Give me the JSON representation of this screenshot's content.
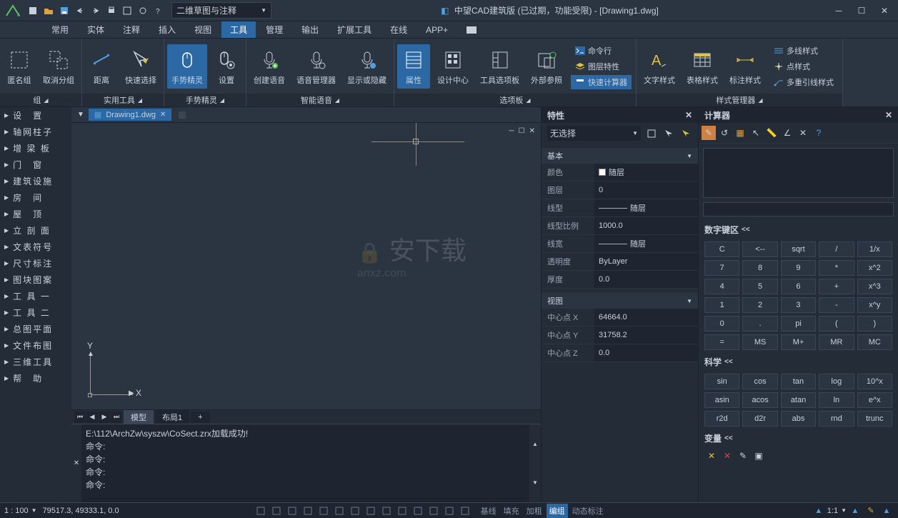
{
  "titlebar": {
    "workspace": "二维草图与注释",
    "title": "中望CAD建筑版 (已过期，功能受限) - [Drawing1.dwg]"
  },
  "menubar": {
    "items": [
      "常用",
      "实体",
      "注释",
      "插入",
      "视图",
      "工具",
      "管理",
      "输出",
      "扩展工具",
      "在线",
      "APP+"
    ],
    "active_index": 5
  },
  "ribbon": {
    "groups": [
      {
        "label": "组",
        "buttons": [
          {
            "label": "匿名组",
            "icon": "group-dashed"
          },
          {
            "label": "取消分组",
            "icon": "ungroup"
          }
        ]
      },
      {
        "label": "实用工具",
        "buttons": [
          {
            "label": "距离",
            "icon": "measure-arrow"
          },
          {
            "label": "快速选择",
            "icon": "quick-select"
          }
        ]
      },
      {
        "label": "手势精灵",
        "buttons": [
          {
            "label": "手势精灵",
            "icon": "mouse",
            "active": true
          },
          {
            "label": "设置",
            "icon": "mouse-gear"
          }
        ]
      },
      {
        "label": "智能语音",
        "buttons": [
          {
            "label": "创建语音",
            "icon": "mic-add"
          },
          {
            "label": "语音管理器",
            "icon": "mic-gear"
          },
          {
            "label": "显示或隐藏",
            "icon": "mic-toggle"
          }
        ]
      },
      {
        "label": "选项板",
        "buttons": [
          {
            "label": "属性",
            "icon": "panel-props",
            "active": true
          },
          {
            "label": "设计中心",
            "icon": "panel-design"
          },
          {
            "label": "工具选项板",
            "icon": "panel-toolbox"
          },
          {
            "label": "外部参照",
            "icon": "panel-xref"
          }
        ],
        "side": [
          {
            "label": "命令行",
            "icon": "cmd"
          },
          {
            "label": "图层特性",
            "icon": "layers"
          },
          {
            "label": "快速计算器",
            "icon": "calc",
            "highlight": true
          }
        ]
      },
      {
        "label": "样式管理器",
        "buttons": [
          {
            "label": "文字样式",
            "icon": "text-style"
          },
          {
            "label": "表格样式",
            "icon": "table-style"
          },
          {
            "label": "标注样式",
            "icon": "dim-style"
          }
        ],
        "side": [
          {
            "label": "多线样式",
            "icon": "mline"
          },
          {
            "label": "点样式",
            "icon": "point"
          },
          {
            "label": "多重引线样式",
            "icon": "mleader"
          }
        ]
      }
    ]
  },
  "sidebar": {
    "items": [
      "设　置",
      "轴网柱子",
      "增 梁 板",
      "门　窗",
      "建筑设施",
      "房　间",
      "屋　顶",
      "立 剖 面",
      "文表符号",
      "尺寸标注",
      "图块图案",
      "工 具 一",
      "工 具 二",
      "总图平面",
      "文件布图",
      "三维工具",
      "帮　助"
    ]
  },
  "doc": {
    "tab_name": "Drawing1.dwg",
    "view_tabs": [
      "模型",
      "布局1"
    ],
    "watermark": "安下载"
  },
  "cmd": {
    "lines": [
      "E:\\112\\ArchZw\\syszw\\CoSect.zrx加载成功!",
      "命令:",
      "命令:",
      "命令:",
      "命令:"
    ]
  },
  "props": {
    "title": "特性",
    "no_select": "无选择",
    "sections": {
      "basic": {
        "label": "基本",
        "rows": [
          {
            "label": "颜色",
            "value": "随层",
            "swatch": true
          },
          {
            "label": "图层",
            "value": "0"
          },
          {
            "label": "线型",
            "value": "随层",
            "line": true
          },
          {
            "label": "线型比例",
            "value": "1000.0"
          },
          {
            "label": "线宽",
            "value": "随层",
            "line": true
          },
          {
            "label": "透明度",
            "value": "ByLayer"
          },
          {
            "label": "厚度",
            "value": "0.0"
          }
        ]
      },
      "view": {
        "label": "视图",
        "rows": [
          {
            "label": "中心点 X",
            "value": "64664.0"
          },
          {
            "label": "中心点 Y",
            "value": "31758.2"
          },
          {
            "label": "中心点 Z",
            "value": "0.0"
          }
        ]
      }
    }
  },
  "calc": {
    "title": "计算器",
    "numpad_label": "数字键区",
    "sci_label": "科学",
    "var_label": "变量",
    "numpad": [
      [
        "C",
        "<--",
        "sqrt",
        "/",
        "1/x"
      ],
      [
        "7",
        "8",
        "9",
        "*",
        "x^2"
      ],
      [
        "4",
        "5",
        "6",
        "+",
        "x^3"
      ],
      [
        "1",
        "2",
        "3",
        "-",
        "x^y"
      ],
      [
        "0",
        ".",
        "pi",
        "(",
        ")"
      ],
      [
        "=",
        "MS",
        "M+",
        "MR",
        "MC"
      ]
    ],
    "sci": [
      [
        "sin",
        "cos",
        "tan",
        "log",
        "10^x"
      ],
      [
        "asin",
        "acos",
        "atan",
        "ln",
        "e^x"
      ],
      [
        "r2d",
        "d2r",
        "abs",
        "rnd",
        "trunc"
      ]
    ]
  },
  "status": {
    "scale": "1 : 100",
    "coords": "79517.3, 49333.1, 0.0",
    "text_btns": [
      "基线",
      "填充",
      "加粗",
      "编组",
      "动态标注"
    ],
    "right_scale": "1:1"
  }
}
